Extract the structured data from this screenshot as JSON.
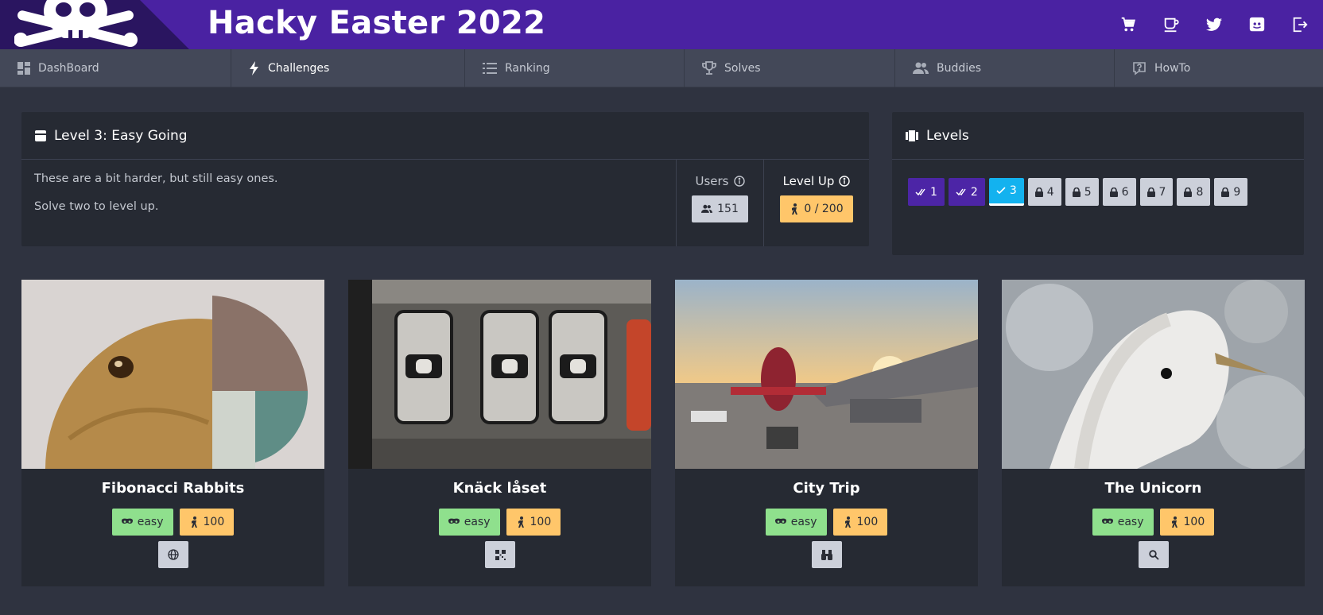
{
  "header": {
    "title": "Hacky Easter 2022",
    "icons": [
      "shop-icon",
      "coffee-icon",
      "twitter-icon",
      "discord-icon",
      "logout-icon"
    ]
  },
  "nav": {
    "items": [
      {
        "label": "DashBoard",
        "icon": "dashboard-icon"
      },
      {
        "label": "Challenges",
        "icon": "lightning-icon",
        "active": true
      },
      {
        "label": "Ranking",
        "icon": "list-icon"
      },
      {
        "label": "Solves",
        "icon": "trophy-icon"
      },
      {
        "label": "Buddies",
        "icon": "people-icon"
      },
      {
        "label": "HowTo",
        "icon": "help-icon"
      }
    ]
  },
  "level": {
    "title": "Level 3: Easy Going",
    "desc1": "These are a bit harder, but still easy ones.",
    "desc2": "Solve two to level up.",
    "users_label": "Users",
    "users_count": "151",
    "levelup_label": "Level Up",
    "levelup_value": "0 / 200"
  },
  "levels": {
    "title": "Levels",
    "buttons": [
      {
        "label": "1",
        "state": "done"
      },
      {
        "label": "2",
        "state": "done"
      },
      {
        "label": "3",
        "state": "current"
      },
      {
        "label": "4",
        "state": "locked"
      },
      {
        "label": "5",
        "state": "locked"
      },
      {
        "label": "6",
        "state": "locked"
      },
      {
        "label": "7",
        "state": "locked"
      },
      {
        "label": "8",
        "state": "locked"
      },
      {
        "label": "9",
        "state": "locked"
      }
    ]
  },
  "cards": [
    {
      "title": "Fibonacci Rabbits",
      "difficulty": "easy",
      "points": "100",
      "category_icon": "globe-icon"
    },
    {
      "title": "Knäck låset",
      "difficulty": "easy",
      "points": "100",
      "category_icon": "qr-icon"
    },
    {
      "title": "City Trip",
      "difficulty": "easy",
      "points": "100",
      "category_icon": "binoculars-icon"
    },
    {
      "title": "The Unicorn",
      "difficulty": "easy",
      "points": "100",
      "category_icon": "magnifier-icon"
    }
  ],
  "colors": {
    "header": "#4a22a2",
    "done_level": "#4c25a6",
    "current_level": "#13b2ef",
    "easy": "#8fe08d",
    "points": "#ffc66a"
  }
}
